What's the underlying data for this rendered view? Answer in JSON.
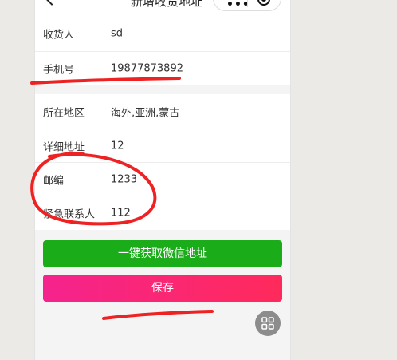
{
  "navbar": {
    "title": "新增收货地址"
  },
  "section1": [
    {
      "label": "收货人",
      "value": "sd"
    },
    {
      "label": "手机号",
      "value": "19877873892"
    }
  ],
  "section2": [
    {
      "label": "所在地区",
      "value": "海外,亚洲,蒙古"
    },
    {
      "label": "详细地址",
      "value": "12"
    },
    {
      "label": "邮编",
      "value": "1233"
    },
    {
      "label": "紧急联系人",
      "value": "112"
    }
  ],
  "buttons": {
    "wechat_address": "一键获取微信地址",
    "save": "保存"
  },
  "colors": {
    "wechat_green": "#1aad19",
    "save_pink_start": "#f5238d",
    "save_pink_end": "#ff2a5b",
    "annotation_red": "#ee2222"
  },
  "icons": {
    "back": "back-arrow-icon",
    "menu": "more-dots-icon",
    "close": "capsule-close-icon",
    "float": "grid-icon"
  }
}
